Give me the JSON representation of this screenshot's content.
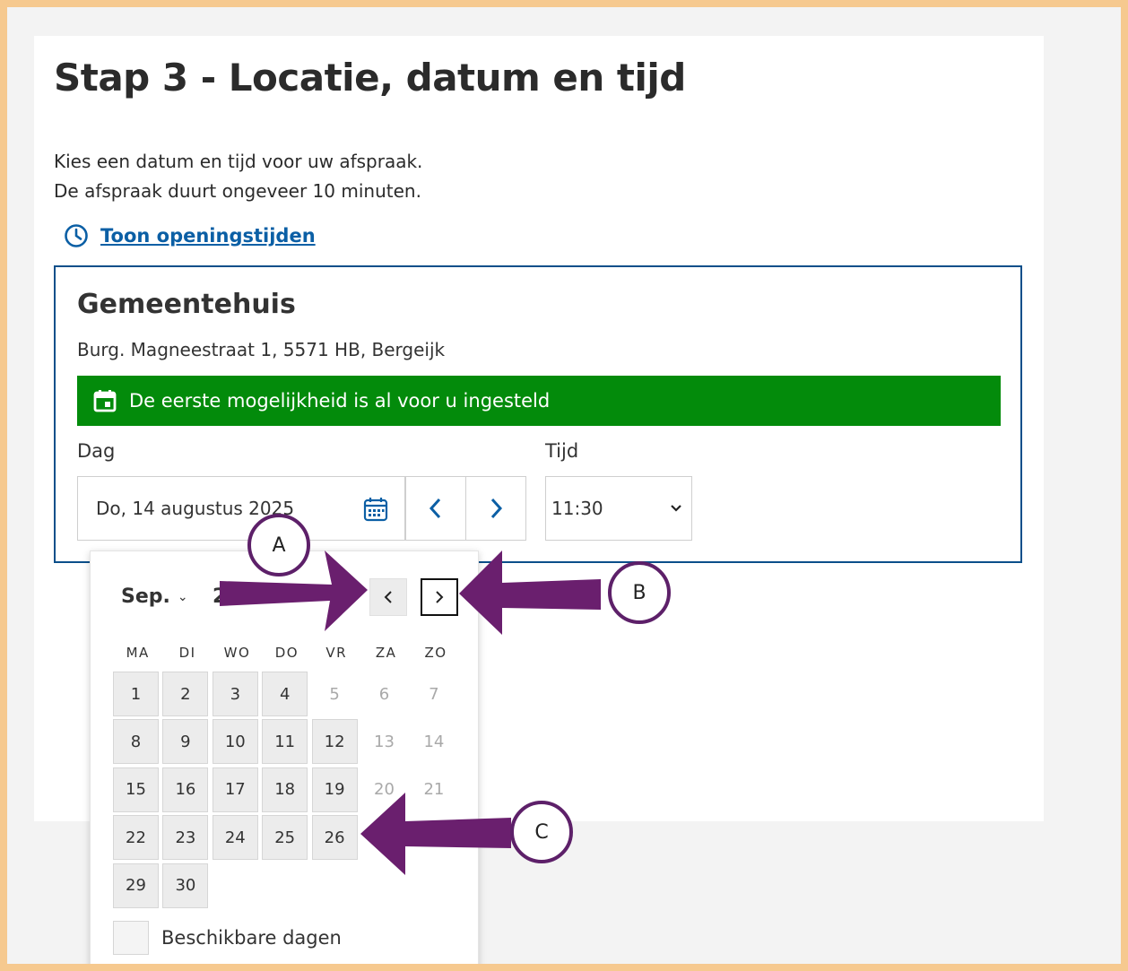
{
  "page": {
    "title": "Stap 3 - Locatie, datum en tijd",
    "intro_line1": "Kies een datum en tijd voor uw afspraak.",
    "intro_line2": "De afspraak duurt ongeveer 10 minuten.",
    "hours_link": "Toon openingstijden"
  },
  "location": {
    "name": "Gemeentehuis",
    "address": "Burg. Magneestraat 1, 5571 HB, Bergeijk",
    "banner": "De eerste mogelijkheid is al voor u ingesteld",
    "banner_color": "#038b0b"
  },
  "form": {
    "day_label": "Dag",
    "day_value": "Do, 14 augustus 2025",
    "time_label": "Tijd",
    "time_value": "11:30",
    "prev_icon": "chevron-left-icon",
    "next_icon": "chevron-right-icon"
  },
  "picker": {
    "month": "Sep.",
    "year_partial": "2",
    "weekdays": [
      "MA",
      "DI",
      "WO",
      "DO",
      "VR",
      "ZA",
      "ZO"
    ],
    "days": [
      {
        "d": "1",
        "avail": true
      },
      {
        "d": "2",
        "avail": true
      },
      {
        "d": "3",
        "avail": true
      },
      {
        "d": "4",
        "avail": true
      },
      {
        "d": "5",
        "avail": false
      },
      {
        "d": "6",
        "avail": false
      },
      {
        "d": "7",
        "avail": false
      },
      {
        "d": "8",
        "avail": true
      },
      {
        "d": "9",
        "avail": true
      },
      {
        "d": "10",
        "avail": true
      },
      {
        "d": "11",
        "avail": true
      },
      {
        "d": "12",
        "avail": true
      },
      {
        "d": "13",
        "avail": false
      },
      {
        "d": "14",
        "avail": false
      },
      {
        "d": "15",
        "avail": true
      },
      {
        "d": "16",
        "avail": true
      },
      {
        "d": "17",
        "avail": true
      },
      {
        "d": "18",
        "avail": true
      },
      {
        "d": "19",
        "avail": true
      },
      {
        "d": "20",
        "avail": false
      },
      {
        "d": "21",
        "avail": false
      },
      {
        "d": "22",
        "avail": true
      },
      {
        "d": "23",
        "avail": true
      },
      {
        "d": "24",
        "avail": true
      },
      {
        "d": "25",
        "avail": true
      },
      {
        "d": "26",
        "avail": true
      },
      {
        "d": "29",
        "avail": true
      },
      {
        "d": "30",
        "avail": true
      }
    ],
    "legend": "Beschikbare dagen"
  },
  "annotations": {
    "a": "A",
    "b": "B",
    "c": "C",
    "arrow_color": "#6a1f6e"
  }
}
